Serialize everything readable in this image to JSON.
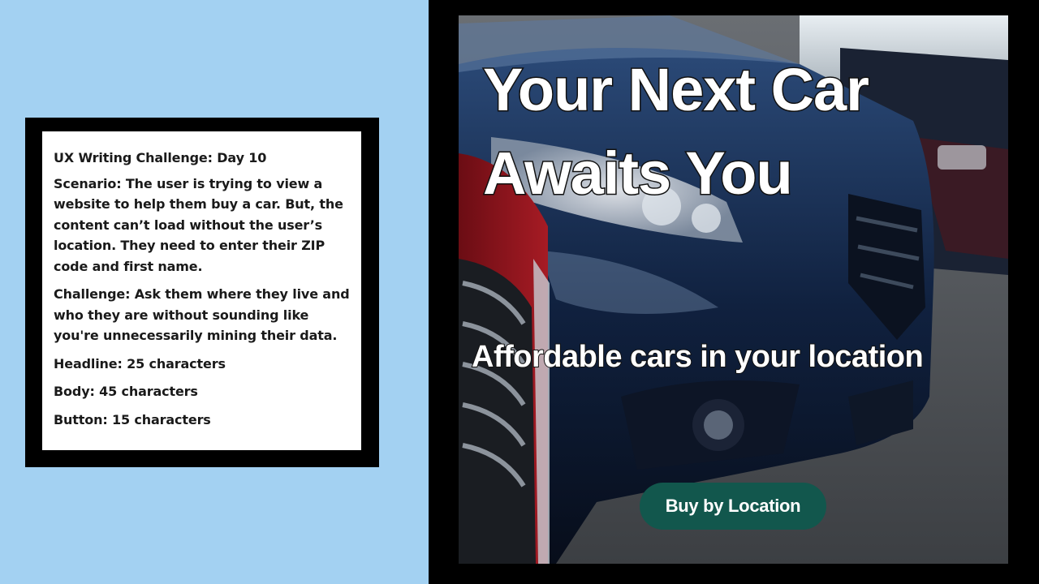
{
  "challenge": {
    "title": "UX Writing Challenge: Day 10",
    "scenario": "Scenario: The user is trying to view a website to help them buy a car. But, the content can’t load without the user’s location. They need to enter their ZIP code and first name.",
    "task": "Challenge: Ask them where they live and who they are without sounding like you're unnecessarily mining their data.",
    "headline_limit": "Headline: 25 characters",
    "body_limit": "Body: 45 characters",
    "button_limit": "Button: 15 characters"
  },
  "ad": {
    "headline": "Your Next Car Awaits You",
    "subheadline": "Affordable cars in your location",
    "cta_label": "Buy by Location"
  },
  "colors": {
    "left_background": "#a3d1f2",
    "frame": "#000000",
    "button": "#12574d",
    "button_text": "#ffffff"
  }
}
